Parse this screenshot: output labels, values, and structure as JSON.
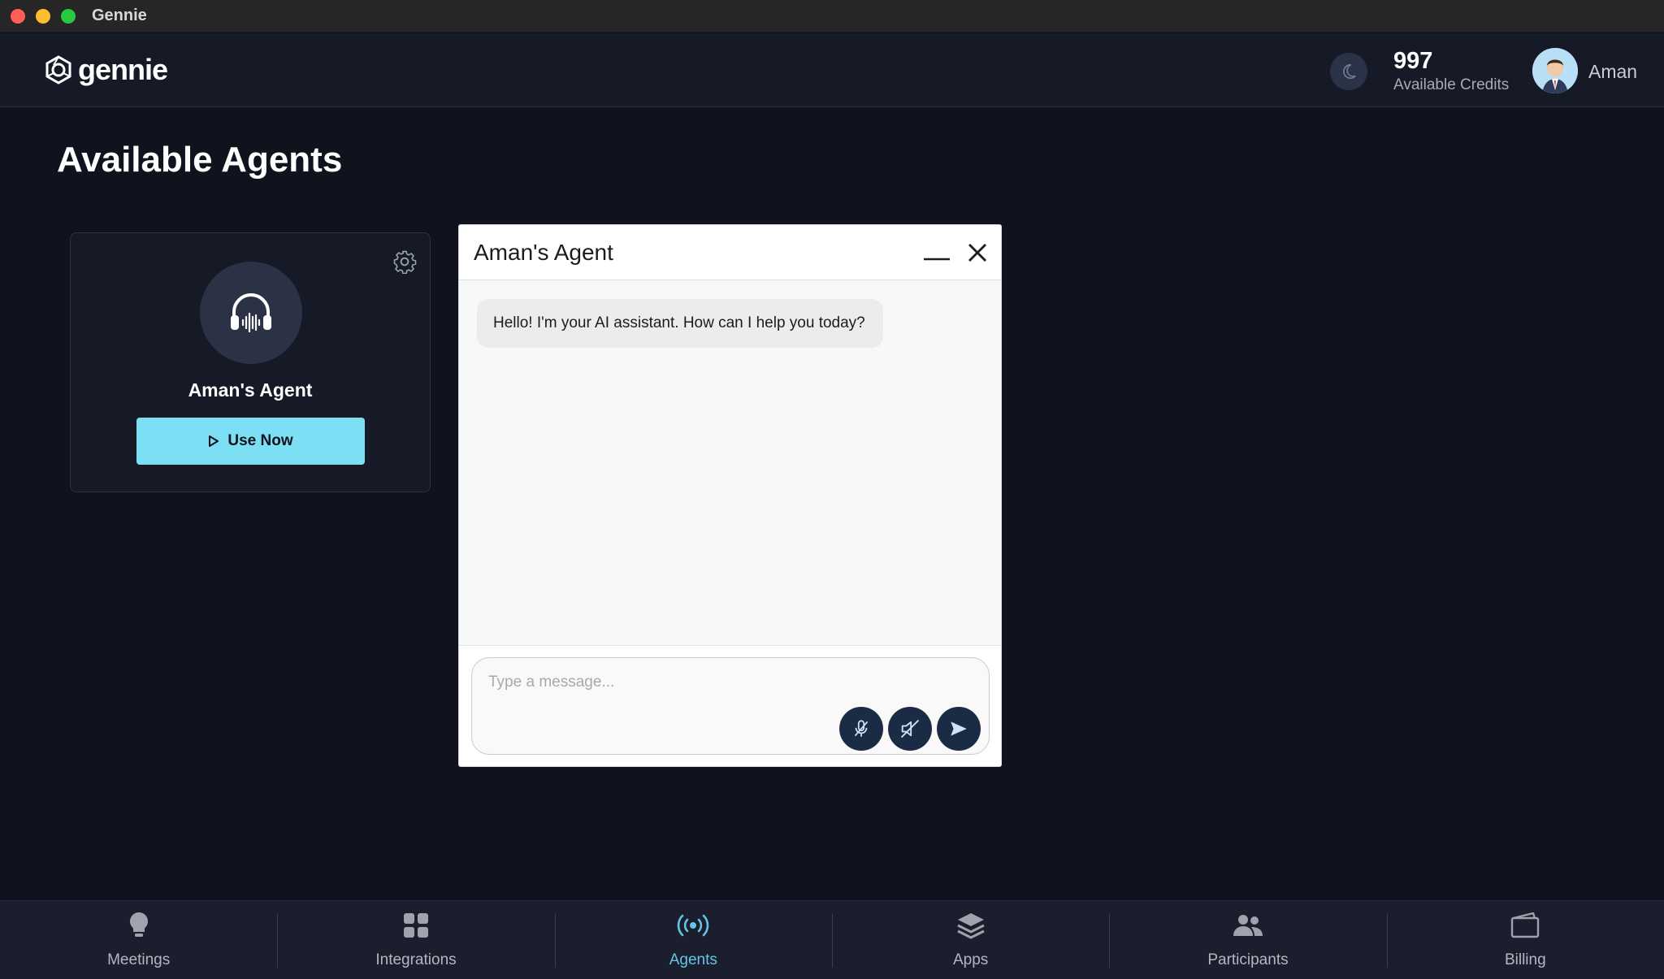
{
  "window": {
    "title": "Gennie"
  },
  "header": {
    "logo_text": "gennie",
    "credits_value": "997",
    "credits_label": "Available Credits",
    "user_name": "Aman"
  },
  "page": {
    "title": "Available Agents"
  },
  "agent_card": {
    "name": "Aman's Agent",
    "use_now_label": "Use Now"
  },
  "chat": {
    "title": "Aman's Agent",
    "messages": [
      {
        "sender": "assistant",
        "text": "Hello! I'm your AI assistant. How can I help you today?"
      }
    ],
    "input_placeholder": "Type a message...",
    "input_value": ""
  },
  "nav": {
    "items": [
      {
        "label": "Meetings",
        "icon": "lightbulb-icon",
        "active": false
      },
      {
        "label": "Integrations",
        "icon": "grid-icon",
        "active": false
      },
      {
        "label": "Agents",
        "icon": "broadcast-icon",
        "active": true
      },
      {
        "label": "Apps",
        "icon": "layers-icon",
        "active": false
      },
      {
        "label": "Participants",
        "icon": "people-icon",
        "active": false
      },
      {
        "label": "Billing",
        "icon": "wallet-icon",
        "active": false
      }
    ]
  },
  "colors": {
    "background": "#0f131d",
    "header": "#161a27",
    "accent": "#7ddff3",
    "active_nav": "#64c6e6",
    "chat_button": "#1c2b44"
  }
}
